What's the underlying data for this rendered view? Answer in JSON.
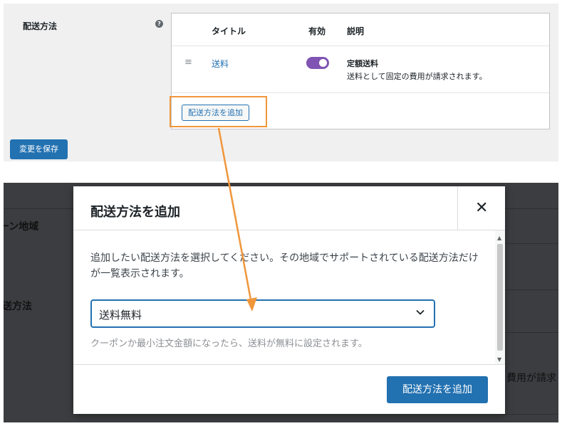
{
  "settings": {
    "row_label": "配送方法",
    "help_icon": "question-circle-icon",
    "table": {
      "col_title": "タイトル",
      "col_enabled": "有効",
      "col_description": "説明",
      "rows": [
        {
          "title": "送料",
          "enabled": true,
          "desc_title": "定額送料",
          "desc_text": "送料として固定の費用が請求されます。"
        }
      ],
      "add_button": "配送方法を追加"
    },
    "save_button": "変更を保存",
    "toggle_color": "#7f54b3"
  },
  "background": {
    "zone_label": "ーン地域",
    "method_label": "送方法",
    "right_text": "費用が請求"
  },
  "modal": {
    "title": "配送方法を追加",
    "close_icon": "close-icon",
    "intro": "追加したい配送方法を選択してください。その地域でサポートされている配送方法だけが一覧表示されます。",
    "select_value": "送料無料",
    "helper": "クーポンか最小注文金額になったら、送料が無料に設定されます。",
    "add_button": "配送方法を追加"
  },
  "colors": {
    "primary": "#2271b1",
    "highlight": "#f0963a",
    "overlay": "#3b3d40"
  }
}
